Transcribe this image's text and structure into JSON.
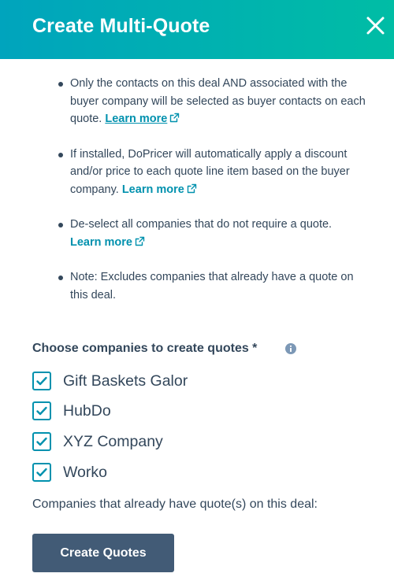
{
  "header": {
    "title": "Create Multi-Quote",
    "close_icon": "close-icon"
  },
  "colors": {
    "header_gradient_start": "#00a4bd",
    "header_gradient_end": "#00bda5",
    "link": "#0091ae",
    "text": "#33475b",
    "checkbox_border": "#0091ae",
    "primary_button": "#425b76",
    "info_icon": "#7c98b6"
  },
  "bullets": [
    {
      "text": "Only the contacts on this deal AND associated with the buyer company will be selected as buyer contacts on each quote. ",
      "link": "Learn more"
    },
    {
      "text": "If installed, DoPricer will automatically apply a discount and/or price to each quote line item based on the buyer company. ",
      "link": "Learn more"
    },
    {
      "text": "De-select all companies that do not require a quote. ",
      "link": "Learn more"
    },
    {
      "text": "Note: Excludes companies that already have a quote on this deal."
    }
  ],
  "companies_section": {
    "label": "Choose companies to create quotes *",
    "info_icon": "info-icon",
    "companies": [
      {
        "name": "Gift Baskets Galor",
        "checked": true
      },
      {
        "name": "HubDo",
        "checked": true
      },
      {
        "name": "XYZ Company",
        "checked": true
      },
      {
        "name": "Worko",
        "checked": true
      }
    ]
  },
  "existing_quotes_label": "Companies that already have quote(s) on this deal:",
  "create_button_label": "Create Quotes"
}
